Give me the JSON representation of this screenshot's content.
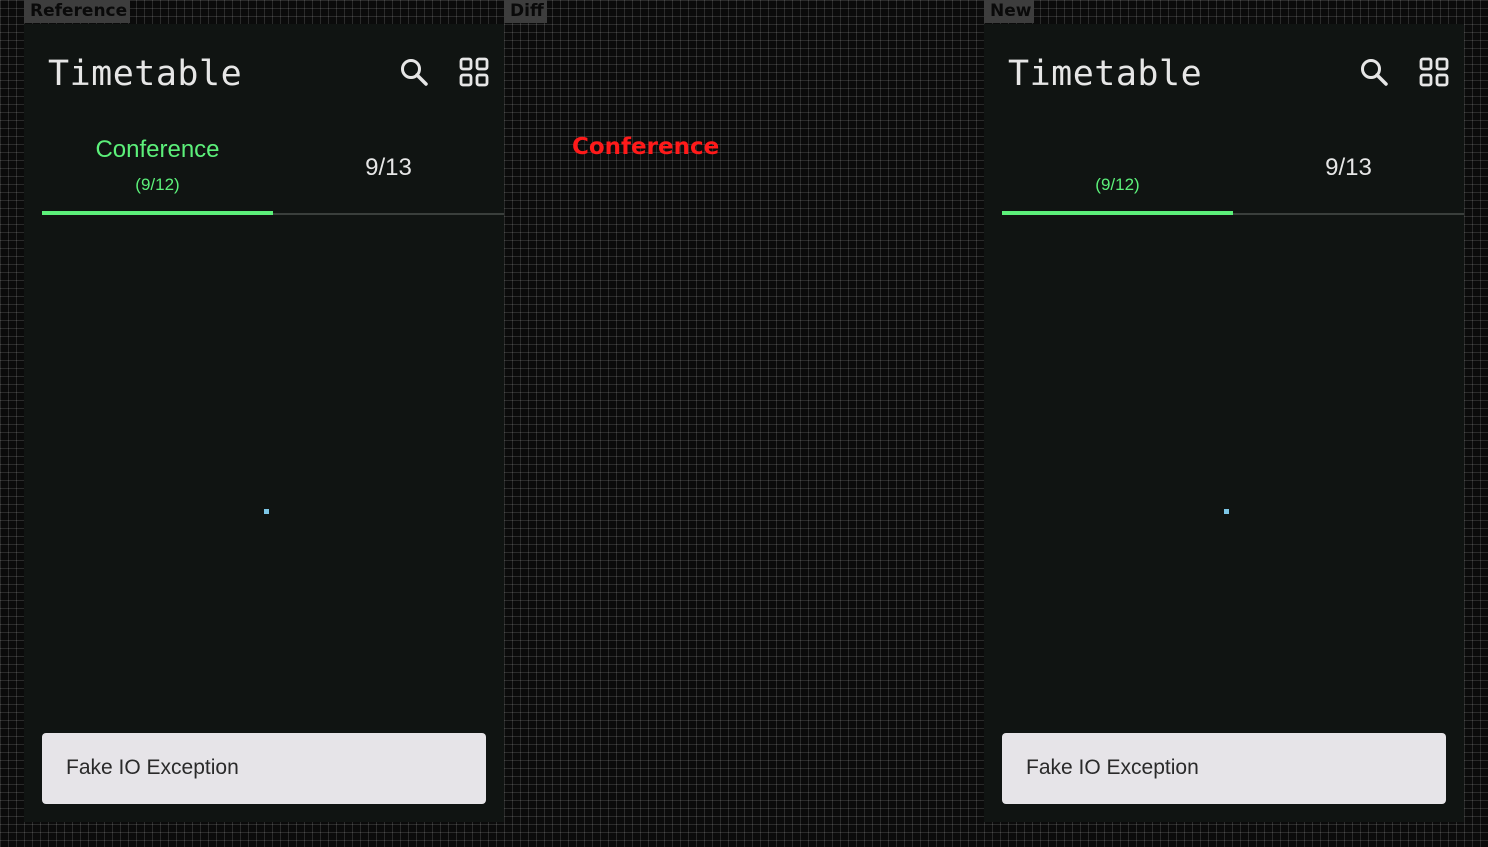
{
  "labels": {
    "reference": "Reference",
    "diff": "Diff",
    "new": "New"
  },
  "reference_panel": {
    "title": "Timetable",
    "search_icon": "search-icon",
    "grid_icon": "grid-view-icon",
    "tabs": [
      {
        "label": "Conference",
        "sublabel": "(9/12)",
        "selected": true
      },
      {
        "label": "9/13",
        "sublabel": "",
        "selected": false
      }
    ],
    "snackbar": "Fake IO Exception"
  },
  "diff_panel": {
    "text": "Conference"
  },
  "new_panel": {
    "title": "Timetable",
    "search_icon": "search-icon",
    "grid_icon": "grid-view-icon",
    "tabs": [
      {
        "label": "",
        "sublabel": "(9/12)",
        "selected": true
      },
      {
        "label": "9/13",
        "sublabel": "",
        "selected": false
      }
    ],
    "snackbar": "Fake IO Exception"
  },
  "colors": {
    "accent": "#5cf07a",
    "background": "#101412",
    "snackbar": "#e6e4e8",
    "diff": "#ff1a1a",
    "spinner": "#7cc6e6"
  }
}
